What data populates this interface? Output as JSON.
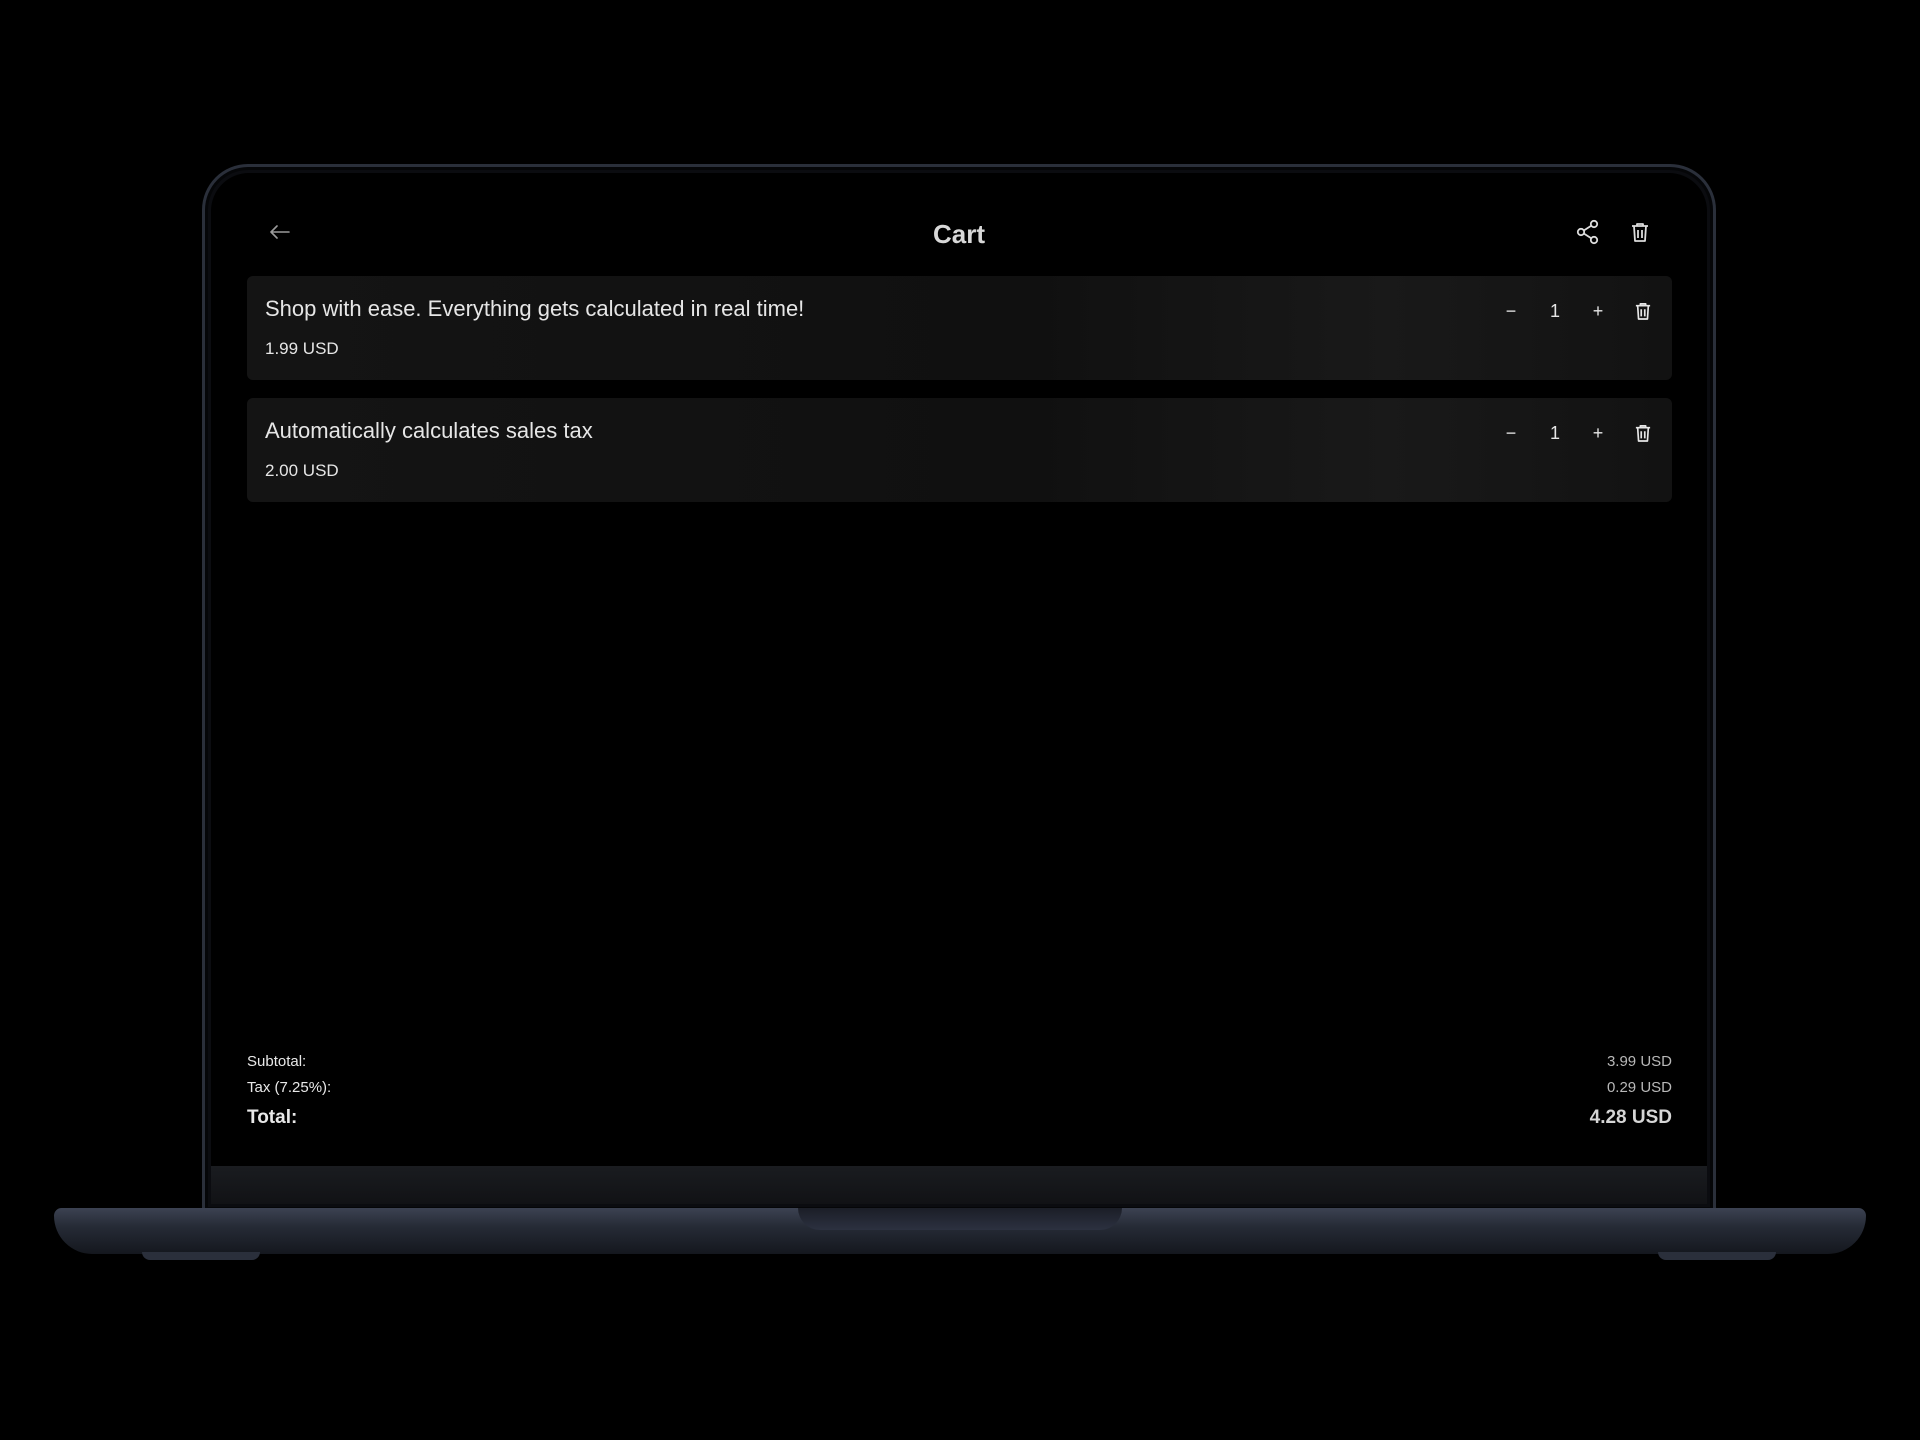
{
  "header": {
    "title": "Cart",
    "back_icon": "arrow-left-icon",
    "share_icon": "share-icon",
    "clear_icon": "trash-icon"
  },
  "cart": {
    "items": [
      {
        "name": "Shop with ease. Everything gets calculated in real time!",
        "price": "1.99 USD",
        "quantity": "1"
      },
      {
        "name": "Automatically calculates sales tax",
        "price": "2.00 USD",
        "quantity": "1"
      }
    ],
    "minus_label": "−",
    "plus_label": "+"
  },
  "summary": {
    "subtotal_label": "Subtotal:",
    "subtotal_value": "3.99 USD",
    "tax_label": "Tax (7.25%):",
    "tax_value": "0.29 USD",
    "total_label": "Total:",
    "total_value": "4.28 USD"
  },
  "colors": {
    "background": "#000000",
    "card": "#141414",
    "text": "#e6e6e6"
  }
}
